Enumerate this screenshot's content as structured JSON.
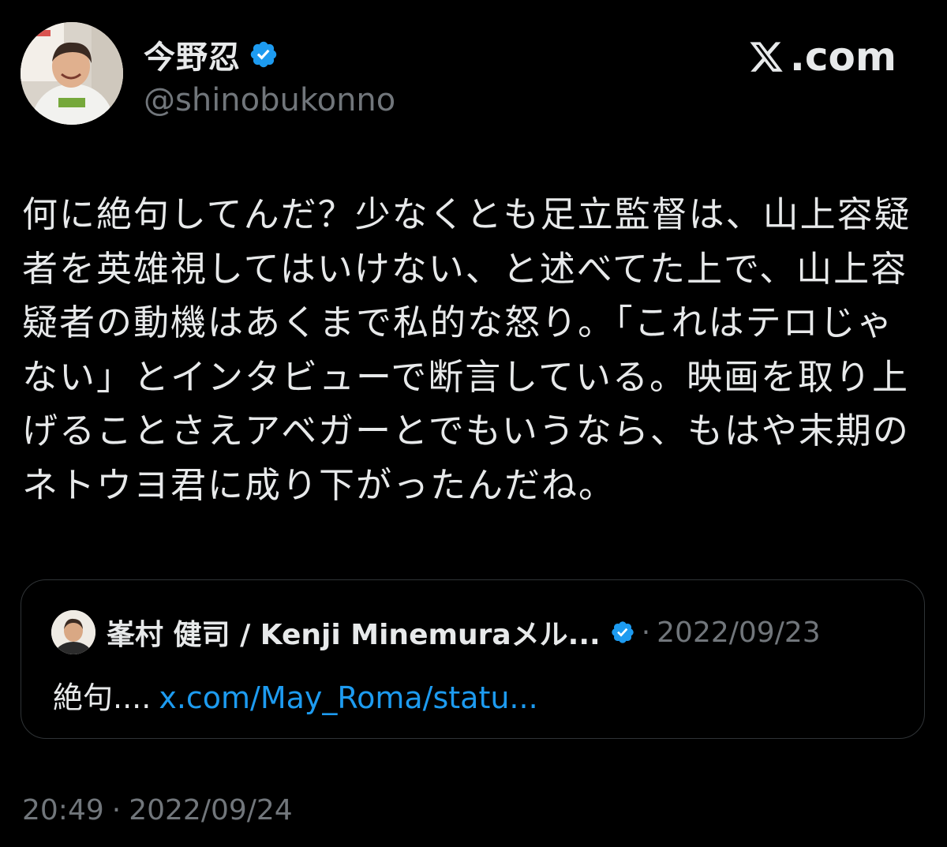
{
  "brand": {
    "label": ".com",
    "logo_icon": "x-logo-icon"
  },
  "author": {
    "display_name": "今野忍",
    "handle": "@shinobukonno",
    "verified_color": "#1d9bf0"
  },
  "tweet": {
    "text": "何に絶句してんだ？少なくとも足立監督は、山上容疑者を英雄視してはいけない、と述べてた上で、山上容疑者の動機はあくまで私的な怒り。「これはテロじゃない」とインタビューで断言している。映画を取り上げることさえアベガーとでもいうなら、もはや末期のネトウヨ君に成り下がったんだね。"
  },
  "quoted_tweet": {
    "author_name": "峯村 健司 / Kenji Minemuraメル...",
    "separator": "·",
    "date": "2022/09/23",
    "text": "絶句....",
    "link_text": "x.com/May_Roma/statu..."
  },
  "footer": {
    "time": "20:49",
    "separator": "·",
    "date": "2022/09/24"
  },
  "colors": {
    "background": "#000000",
    "text": "#e7e9ea",
    "muted": "#71767b",
    "link": "#1d9bf0",
    "border": "#2f3336"
  }
}
